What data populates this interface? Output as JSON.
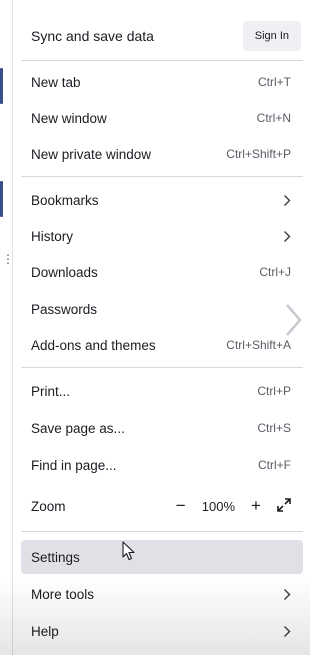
{
  "header": {
    "sync_label": "Sync and save data",
    "signin_label": "Sign In"
  },
  "menu": {
    "new_tab": {
      "label": "New tab",
      "shortcut": "Ctrl+T"
    },
    "new_window": {
      "label": "New window",
      "shortcut": "Ctrl+N"
    },
    "new_private_window": {
      "label": "New private window",
      "shortcut": "Ctrl+Shift+P"
    },
    "bookmarks": {
      "label": "Bookmarks"
    },
    "history": {
      "label": "History"
    },
    "downloads": {
      "label": "Downloads",
      "shortcut": "Ctrl+J"
    },
    "passwords": {
      "label": "Passwords"
    },
    "addons": {
      "label": "Add-ons and themes",
      "shortcut": "Ctrl+Shift+A"
    },
    "print": {
      "label": "Print...",
      "shortcut": "Ctrl+P"
    },
    "save_page": {
      "label": "Save page as...",
      "shortcut": "Ctrl+S"
    },
    "find": {
      "label": "Find in page...",
      "shortcut": "Ctrl+F"
    },
    "zoom": {
      "label": "Zoom",
      "minus": "−",
      "level": "100%",
      "plus": "+"
    },
    "settings": {
      "label": "Settings"
    },
    "more_tools": {
      "label": "More tools"
    },
    "help": {
      "label": "Help"
    }
  },
  "colors": {
    "hover_background": "#e0e0e6",
    "left_accent": "#3b4e8c"
  },
  "icons": [
    "chevron-right-icon",
    "fullscreen-icon",
    "mouse-cursor-icon"
  ]
}
